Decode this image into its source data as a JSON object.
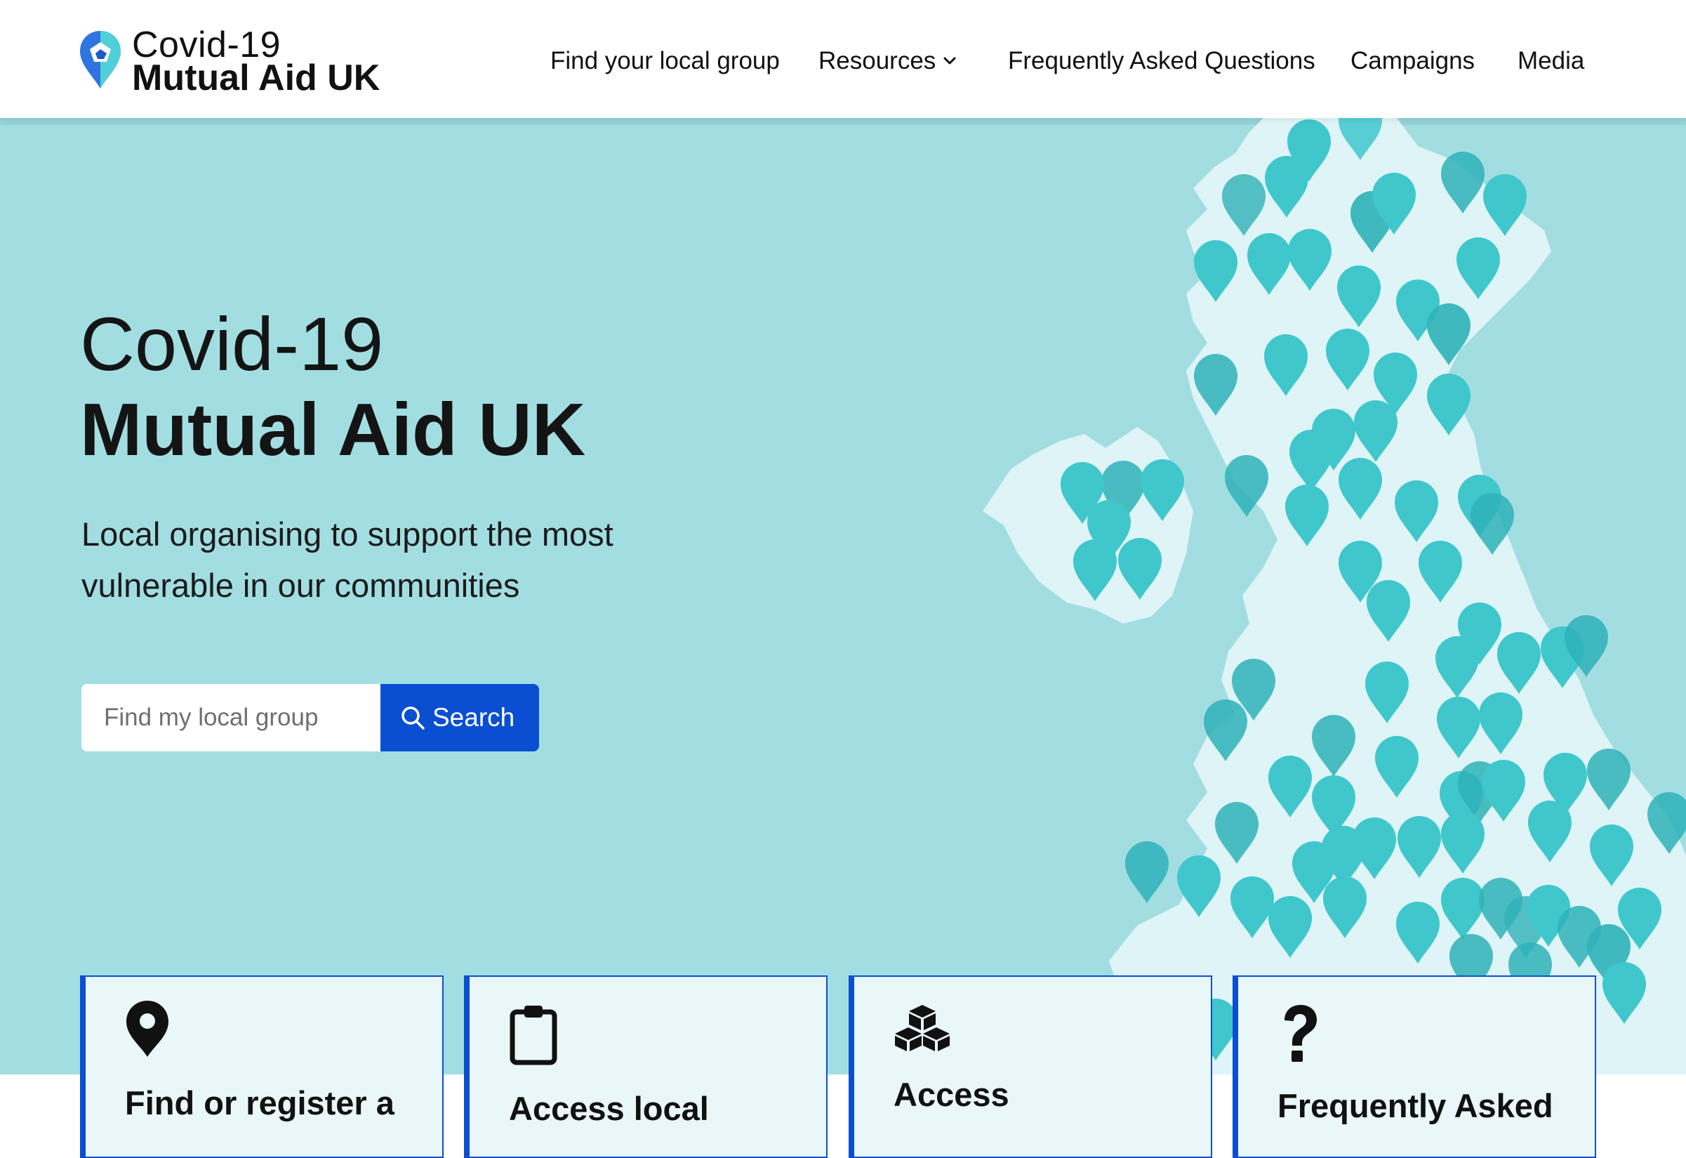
{
  "header": {
    "logo": {
      "line1": "Covid-19",
      "line2": "Mutual Aid UK"
    },
    "nav": [
      {
        "label": "Find your local group"
      },
      {
        "label": "Resources",
        "has_dropdown": true
      },
      {
        "label": "Frequently Asked Questions"
      },
      {
        "label": "Campaigns"
      },
      {
        "label": "Media"
      }
    ]
  },
  "hero": {
    "title_line1": "Covid-19",
    "title_line2": "Mutual Aid UK",
    "subtitle": "Local organising to support the most vulnerable in our communities",
    "search": {
      "placeholder": "Find my local group",
      "value": "",
      "button_label": "Search"
    }
  },
  "cards": [
    {
      "icon": "map-pin-icon",
      "title": "Find or register a"
    },
    {
      "icon": "clipboard-icon",
      "title": "Access local"
    },
    {
      "icon": "boxes-icon",
      "title": "Access"
    },
    {
      "icon": "question-mark-icon",
      "title": "Frequently Asked"
    }
  ],
  "colors": {
    "hero_background": "#a2dee1",
    "map_land": "#dff4f6",
    "map_pin": "#3fc7cc",
    "accent_blue": "#0a4fd2",
    "card_background": "#eaf7f8"
  }
}
